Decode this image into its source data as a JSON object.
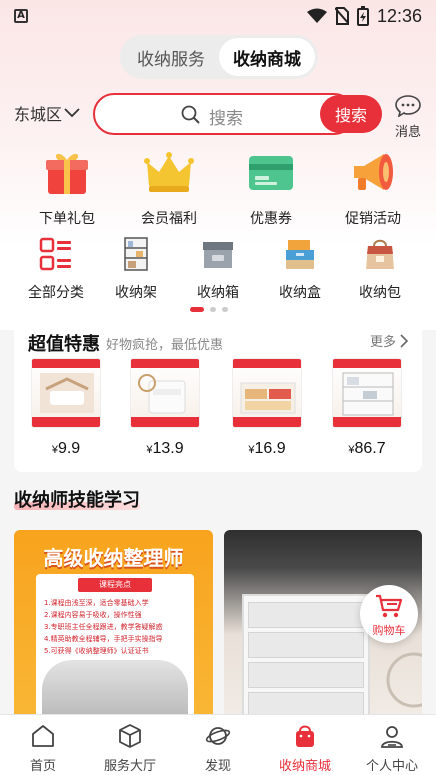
{
  "status_bar": {
    "time": "12:36",
    "left_badge": "A"
  },
  "segmented": {
    "tabs": [
      {
        "label": "收纳服务",
        "active": false
      },
      {
        "label": "收纳商城",
        "active": true
      }
    ]
  },
  "search": {
    "district": "东城区",
    "placeholder": "搜索",
    "button_label": "搜索",
    "message_label": "消息"
  },
  "features": [
    {
      "label": "下单礼包",
      "icon": "gift-icon"
    },
    {
      "label": "会员福利",
      "icon": "crown-icon"
    },
    {
      "label": "优惠券",
      "icon": "coupon-icon"
    },
    {
      "label": "促销活动",
      "icon": "megaphone-icon"
    }
  ],
  "categories": [
    {
      "label": "全部分类",
      "icon": "grid-icon"
    },
    {
      "label": "收纳架",
      "icon": "rack-icon"
    },
    {
      "label": "收纳箱",
      "icon": "storage-box-icon"
    },
    {
      "label": "收纳盒",
      "icon": "storage-case-icon"
    },
    {
      "label": "收纳包",
      "icon": "storage-bag-icon"
    }
  ],
  "deals": {
    "title": "超值特惠",
    "subtitle": "好物疯抢，最低优惠",
    "more_label": "更多",
    "products": [
      {
        "price": "9.9",
        "currency": "¥"
      },
      {
        "price": "13.9",
        "currency": "¥"
      },
      {
        "price": "16.9",
        "currency": "¥"
      },
      {
        "price": "86.7",
        "currency": "¥"
      }
    ]
  },
  "learning": {
    "title": "收纳师技能学习",
    "banner1": {
      "heading": "高级收纳整理师",
      "label": "课程亮点",
      "lines": [
        "1.课程由浅至深，适合零基础入学",
        "2.课程内容易于吸收，操作性强",
        "3.专职班主任全程跟进，教学答疑解惑",
        "4.精英助教全程辅导，手把手实操指导",
        "5.可获得《收纳整理师》认证证书"
      ]
    },
    "cart_label": "购物车"
  },
  "bottom_nav": [
    {
      "label": "首页",
      "icon": "home-icon",
      "active": false
    },
    {
      "label": "服务大厅",
      "icon": "cube-icon",
      "active": false
    },
    {
      "label": "发现",
      "icon": "planet-icon",
      "active": false
    },
    {
      "label": "收纳商城",
      "icon": "bag-icon",
      "active": true
    },
    {
      "label": "个人中心",
      "icon": "person-icon",
      "active": false
    }
  ],
  "colors": {
    "accent": "#e8303a",
    "banner_orange": "#f8a31e"
  }
}
